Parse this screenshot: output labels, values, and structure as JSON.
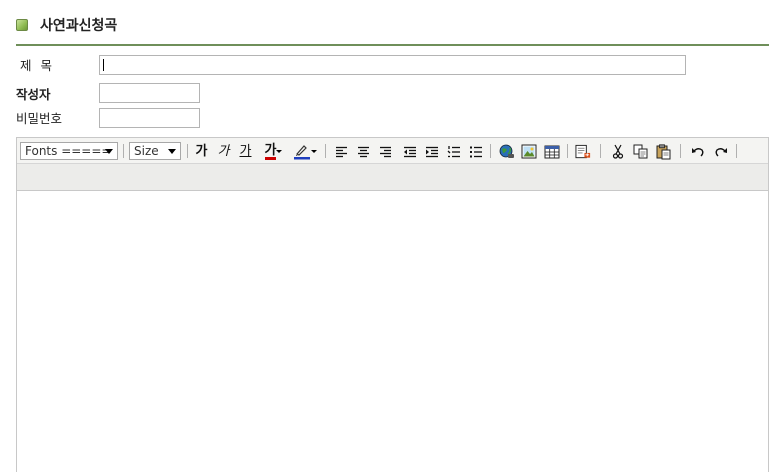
{
  "page": {
    "title": "사연과신청곡"
  },
  "form": {
    "subject_label": "제목",
    "author_label": "작성자",
    "password_label": "비밀번호",
    "subject_value": "",
    "author_value": "",
    "password_value": ""
  },
  "editor": {
    "font_select_label": "Fonts =====",
    "size_select_label": "Size",
    "bold_glyph": "가",
    "italic_glyph": "가",
    "underline_glyph": "가",
    "font_color_glyph": "가",
    "content": ""
  },
  "colors": {
    "title_rule": "#6f8f5a",
    "font_color_underline": "#cc0000",
    "highlight_underline": "#1f3fbf",
    "toolbar_bg": "#f4f4f2"
  },
  "icons": {
    "title_bullet": "green-square-icon",
    "align": [
      "align-left-icon",
      "align-center-icon",
      "align-right-icon"
    ],
    "indent": [
      "outdent-icon",
      "indent-icon"
    ],
    "lists": [
      "ordered-list-icon",
      "unordered-list-icon"
    ],
    "insert": [
      "link-globe-icon",
      "image-icon",
      "table-icon"
    ],
    "misc": [
      "find-replace-icon",
      "cut-icon",
      "copy-icon",
      "paste-icon",
      "undo-icon",
      "redo-icon"
    ]
  }
}
